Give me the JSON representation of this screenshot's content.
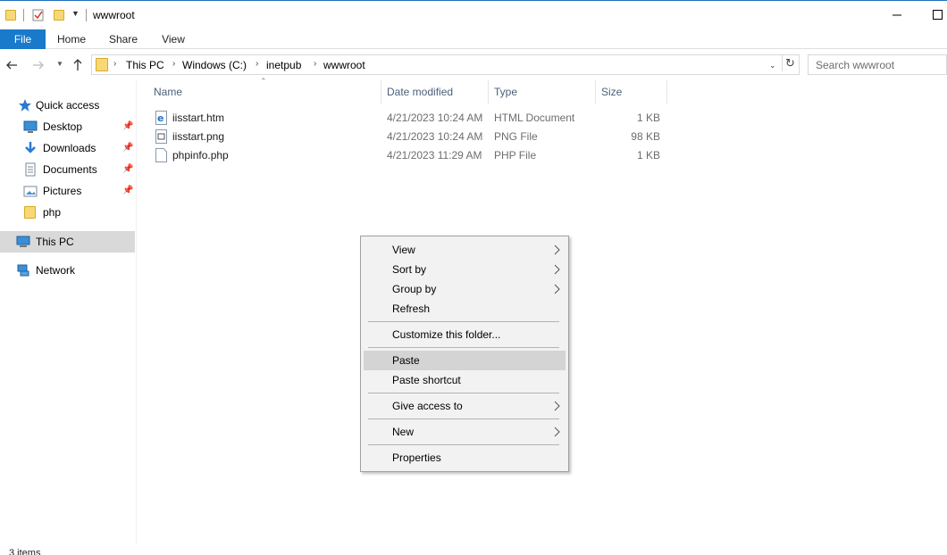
{
  "window": {
    "title": "wwwroot"
  },
  "ribbon": {
    "tabs": [
      "File",
      "Home",
      "Share",
      "View"
    ]
  },
  "address": {
    "crumbs": [
      "This PC",
      "Windows (C:)",
      "inetpub",
      "wwwroot"
    ],
    "search_placeholder": "Search wwwroot"
  },
  "nav": {
    "quick_access": "Quick access",
    "items": [
      {
        "label": "Desktop",
        "icon": "desktop-icon",
        "pinned": true
      },
      {
        "label": "Downloads",
        "icon": "download-icon",
        "pinned": true
      },
      {
        "label": "Documents",
        "icon": "documents-icon",
        "pinned": true
      },
      {
        "label": "Pictures",
        "icon": "pictures-icon",
        "pinned": true
      },
      {
        "label": "php",
        "icon": "folder-icon",
        "pinned": false
      }
    ],
    "this_pc": "This PC",
    "network": "Network"
  },
  "columns": {
    "name": "Name",
    "date": "Date modified",
    "type": "Type",
    "size": "Size"
  },
  "files": [
    {
      "name": "iisstart.htm",
      "date": "4/21/2023 10:24 AM",
      "type": "HTML Document",
      "size": "1 KB",
      "icon": "html-file-icon"
    },
    {
      "name": "iisstart.png",
      "date": "4/21/2023 10:24 AM",
      "type": "PNG File",
      "size": "98 KB",
      "icon": "image-file-icon"
    },
    {
      "name": "phpinfo.php",
      "date": "4/21/2023 11:29 AM",
      "type": "PHP File",
      "size": "1 KB",
      "icon": "file-icon"
    }
  ],
  "status": {
    "items": "3 items"
  },
  "context_menu": {
    "view": "View",
    "sort_by": "Sort by",
    "group_by": "Group by",
    "refresh": "Refresh",
    "customize": "Customize this folder...",
    "paste": "Paste",
    "paste_shortcut": "Paste shortcut",
    "give_access": "Give access to",
    "new": "New",
    "properties": "Properties"
  },
  "colors": {
    "accent": "#1979ca",
    "selection": "#d9d9d9",
    "menu_bg": "#f2f2f2",
    "menu_hover": "#d4d4d4"
  }
}
